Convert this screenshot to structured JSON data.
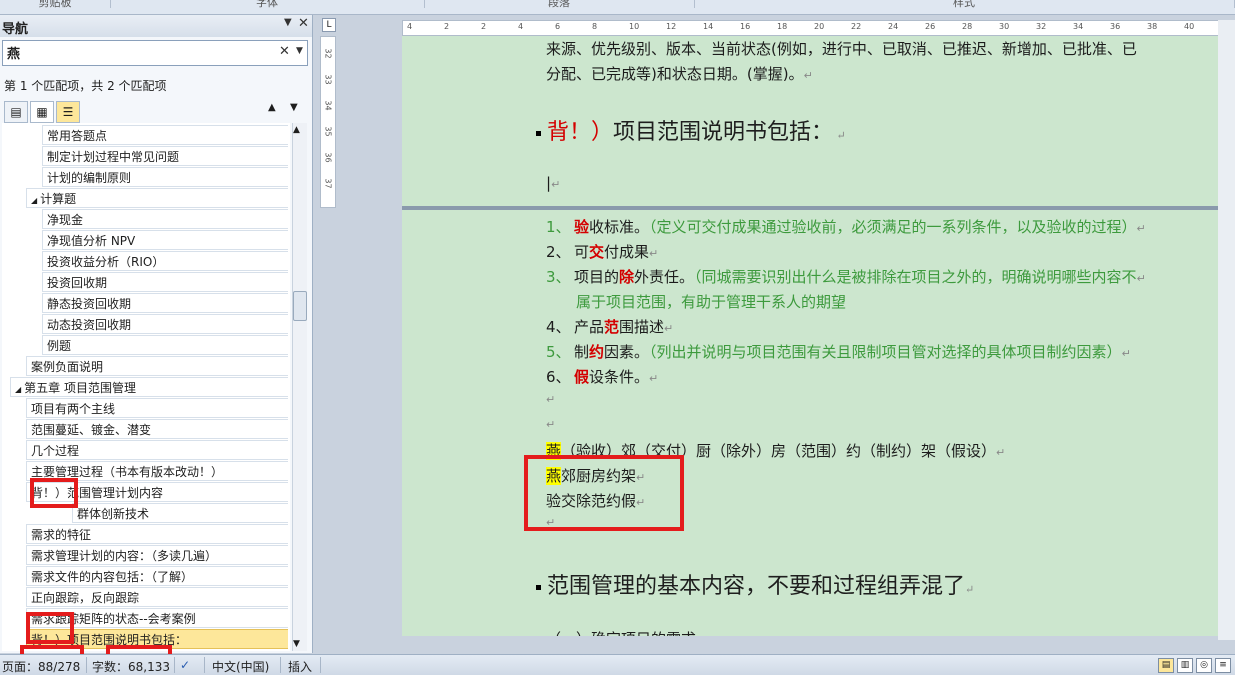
{
  "ribbon": {
    "groups": [
      "剪贴板",
      "字体",
      "段落",
      "样式"
    ]
  },
  "nav": {
    "title": "导航",
    "search_value": "燕",
    "match_text": "第 1 个匹配项，共 2 个匹配项"
  },
  "tree": {
    "items": [
      {
        "label": "常用答题点",
        "level": 2
      },
      {
        "label": "制定计划过程中常见问题",
        "level": 2
      },
      {
        "label": "计划的编制原则",
        "level": 2
      },
      {
        "label": "计算题",
        "level": 1,
        "expanded": true
      },
      {
        "label": "净现金",
        "level": 2
      },
      {
        "label": "净现值分析 NPV",
        "level": 2
      },
      {
        "label": "投资收益分析（RIO）",
        "level": 2
      },
      {
        "label": "投资回收期",
        "level": 2
      },
      {
        "label": "静态投资回收期",
        "level": 2
      },
      {
        "label": "动态投资回收期",
        "level": 2
      },
      {
        "label": "例题",
        "level": 2
      },
      {
        "label": "案例负面说明",
        "level": 1
      },
      {
        "label": "第五章 项目范围管理",
        "level": 0,
        "expanded": true
      },
      {
        "label": "项目有两个主线",
        "level": 1
      },
      {
        "label": "范围蔓延、镀金、潜变",
        "level": 1
      },
      {
        "label": "几个过程",
        "level": 1
      },
      {
        "label": "主要管理过程（书本有版本改动！）",
        "level": 1
      },
      {
        "label": "背！）范围管理计划内容",
        "level": 1
      },
      {
        "label": "群体创新技术",
        "level": 3
      },
      {
        "label": "需求的特征",
        "level": 1
      },
      {
        "label": "需求管理计划的内容：（多读几遍）",
        "level": 1
      },
      {
        "label": "需求文件的内容包括：（了解）",
        "level": 1
      },
      {
        "label": "正向跟踪，反向跟踪",
        "level": 1
      },
      {
        "label": "需求跟踪矩阵的状态--会考案例",
        "level": 1
      },
      {
        "label": "背！）项目范围说明书包括：",
        "level": 1,
        "highlighted": true
      }
    ]
  },
  "rulers": {
    "v_numbers": [
      "32",
      "33",
      "34",
      "35",
      "36",
      "37"
    ],
    "h_numbers": [
      "4",
      "2",
      "2",
      "4",
      "6",
      "8",
      "10",
      "12",
      "14",
      "16",
      "18",
      "20",
      "22",
      "24",
      "26",
      "28",
      "30",
      "32",
      "34",
      "36",
      "38",
      "40"
    ]
  },
  "document": {
    "top_lines": [
      "来源、优先级别、版本、当前状态(例如，进行中、已取消、已推迟、新增加、已批准、已",
      "分配、已完成等)和状态日期。(掌握)。"
    ],
    "heading1_red": "背！）",
    "heading1_rest": "项目范围说明书包括：",
    "list": [
      {
        "num": "1、",
        "key": "验",
        "rest": "收标准。",
        "note": "（定义可交付成果通过验收前，必须满足的一系列条件，以及验收的过程）"
      },
      {
        "num": "2、",
        "pre": "可",
        "key": "交",
        "rest": "付成果"
      },
      {
        "num": "3、",
        "pre": "项目的",
        "key": "除",
        "rest": "外责任。",
        "note": "（同城需要识别出什么是被排除在项目之外的，明确说明哪些内容不",
        "note2": "属于项目范围，有助于管理干系人的期望"
      },
      {
        "num": "4、",
        "pre": "产品",
        "key": "范",
        "rest": "围描述"
      },
      {
        "num": "5、",
        "pre": "制",
        "key": "约",
        "rest": "因素。",
        "note": "（列出并说明与项目范围有关且限制项目管对选择的具体项目制约因素）"
      },
      {
        "num": "6、",
        "key": "假",
        "rest": "设条件。"
      }
    ],
    "mnemonic_hl": "燕",
    "mnemonic_line": "（验收）郊（交付）厨（除外）房（范围）约（制约）架（假设）",
    "memo1_hl": "燕",
    "memo1_rest": "郊厨房约架",
    "memo2": "验交除范约假",
    "heading2": "范围管理的基本内容，不要和过程组弄混了",
    "cut_line": "（一）确定项目的需求"
  },
  "status": {
    "page": "页面：88/278",
    "words": "字数：68,133",
    "language": "中文(中国)",
    "mode": "插入"
  },
  "colors": {
    "page_bg": "#cce6ce",
    "annotation_red": "#e41c1c",
    "note_green": "#3d9a3d",
    "highlight": "#ffff00"
  }
}
